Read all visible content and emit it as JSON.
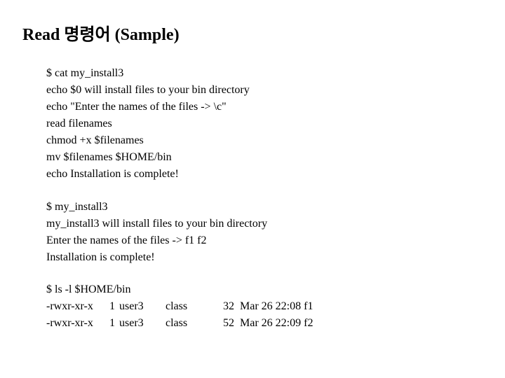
{
  "title": "Read 명령어 (Sample)",
  "cat_block": {
    "lines": [
      "$ cat my_install3",
      "echo $0 will install files to your bin directory",
      "echo \"Enter the names of the files -> \\c\"",
      "read filenames",
      "chmod +x $filenames",
      "mv $filenames $HOME/bin",
      "echo Installation is complete!"
    ]
  },
  "run_block": {
    "lines": [
      "$ my_install3",
      "my_install3 will install files to your bin directory",
      "Enter the names of the files -> f1 f2",
      "Installation is complete!"
    ]
  },
  "ls_block": {
    "command": "$ ls -l $HOME/bin",
    "rows": [
      {
        "perm": "-rwxr-xr-x",
        "links": "1",
        "owner": "user3",
        "group": "class",
        "size": "32",
        "date": "Mar 26 22:08",
        "name": "f1"
      },
      {
        "perm": "-rwxr-xr-x",
        "links": "1",
        "owner": "user3",
        "group": "class",
        "size": "52",
        "date": "Mar 26 22:09",
        "name": "f2"
      }
    ]
  }
}
